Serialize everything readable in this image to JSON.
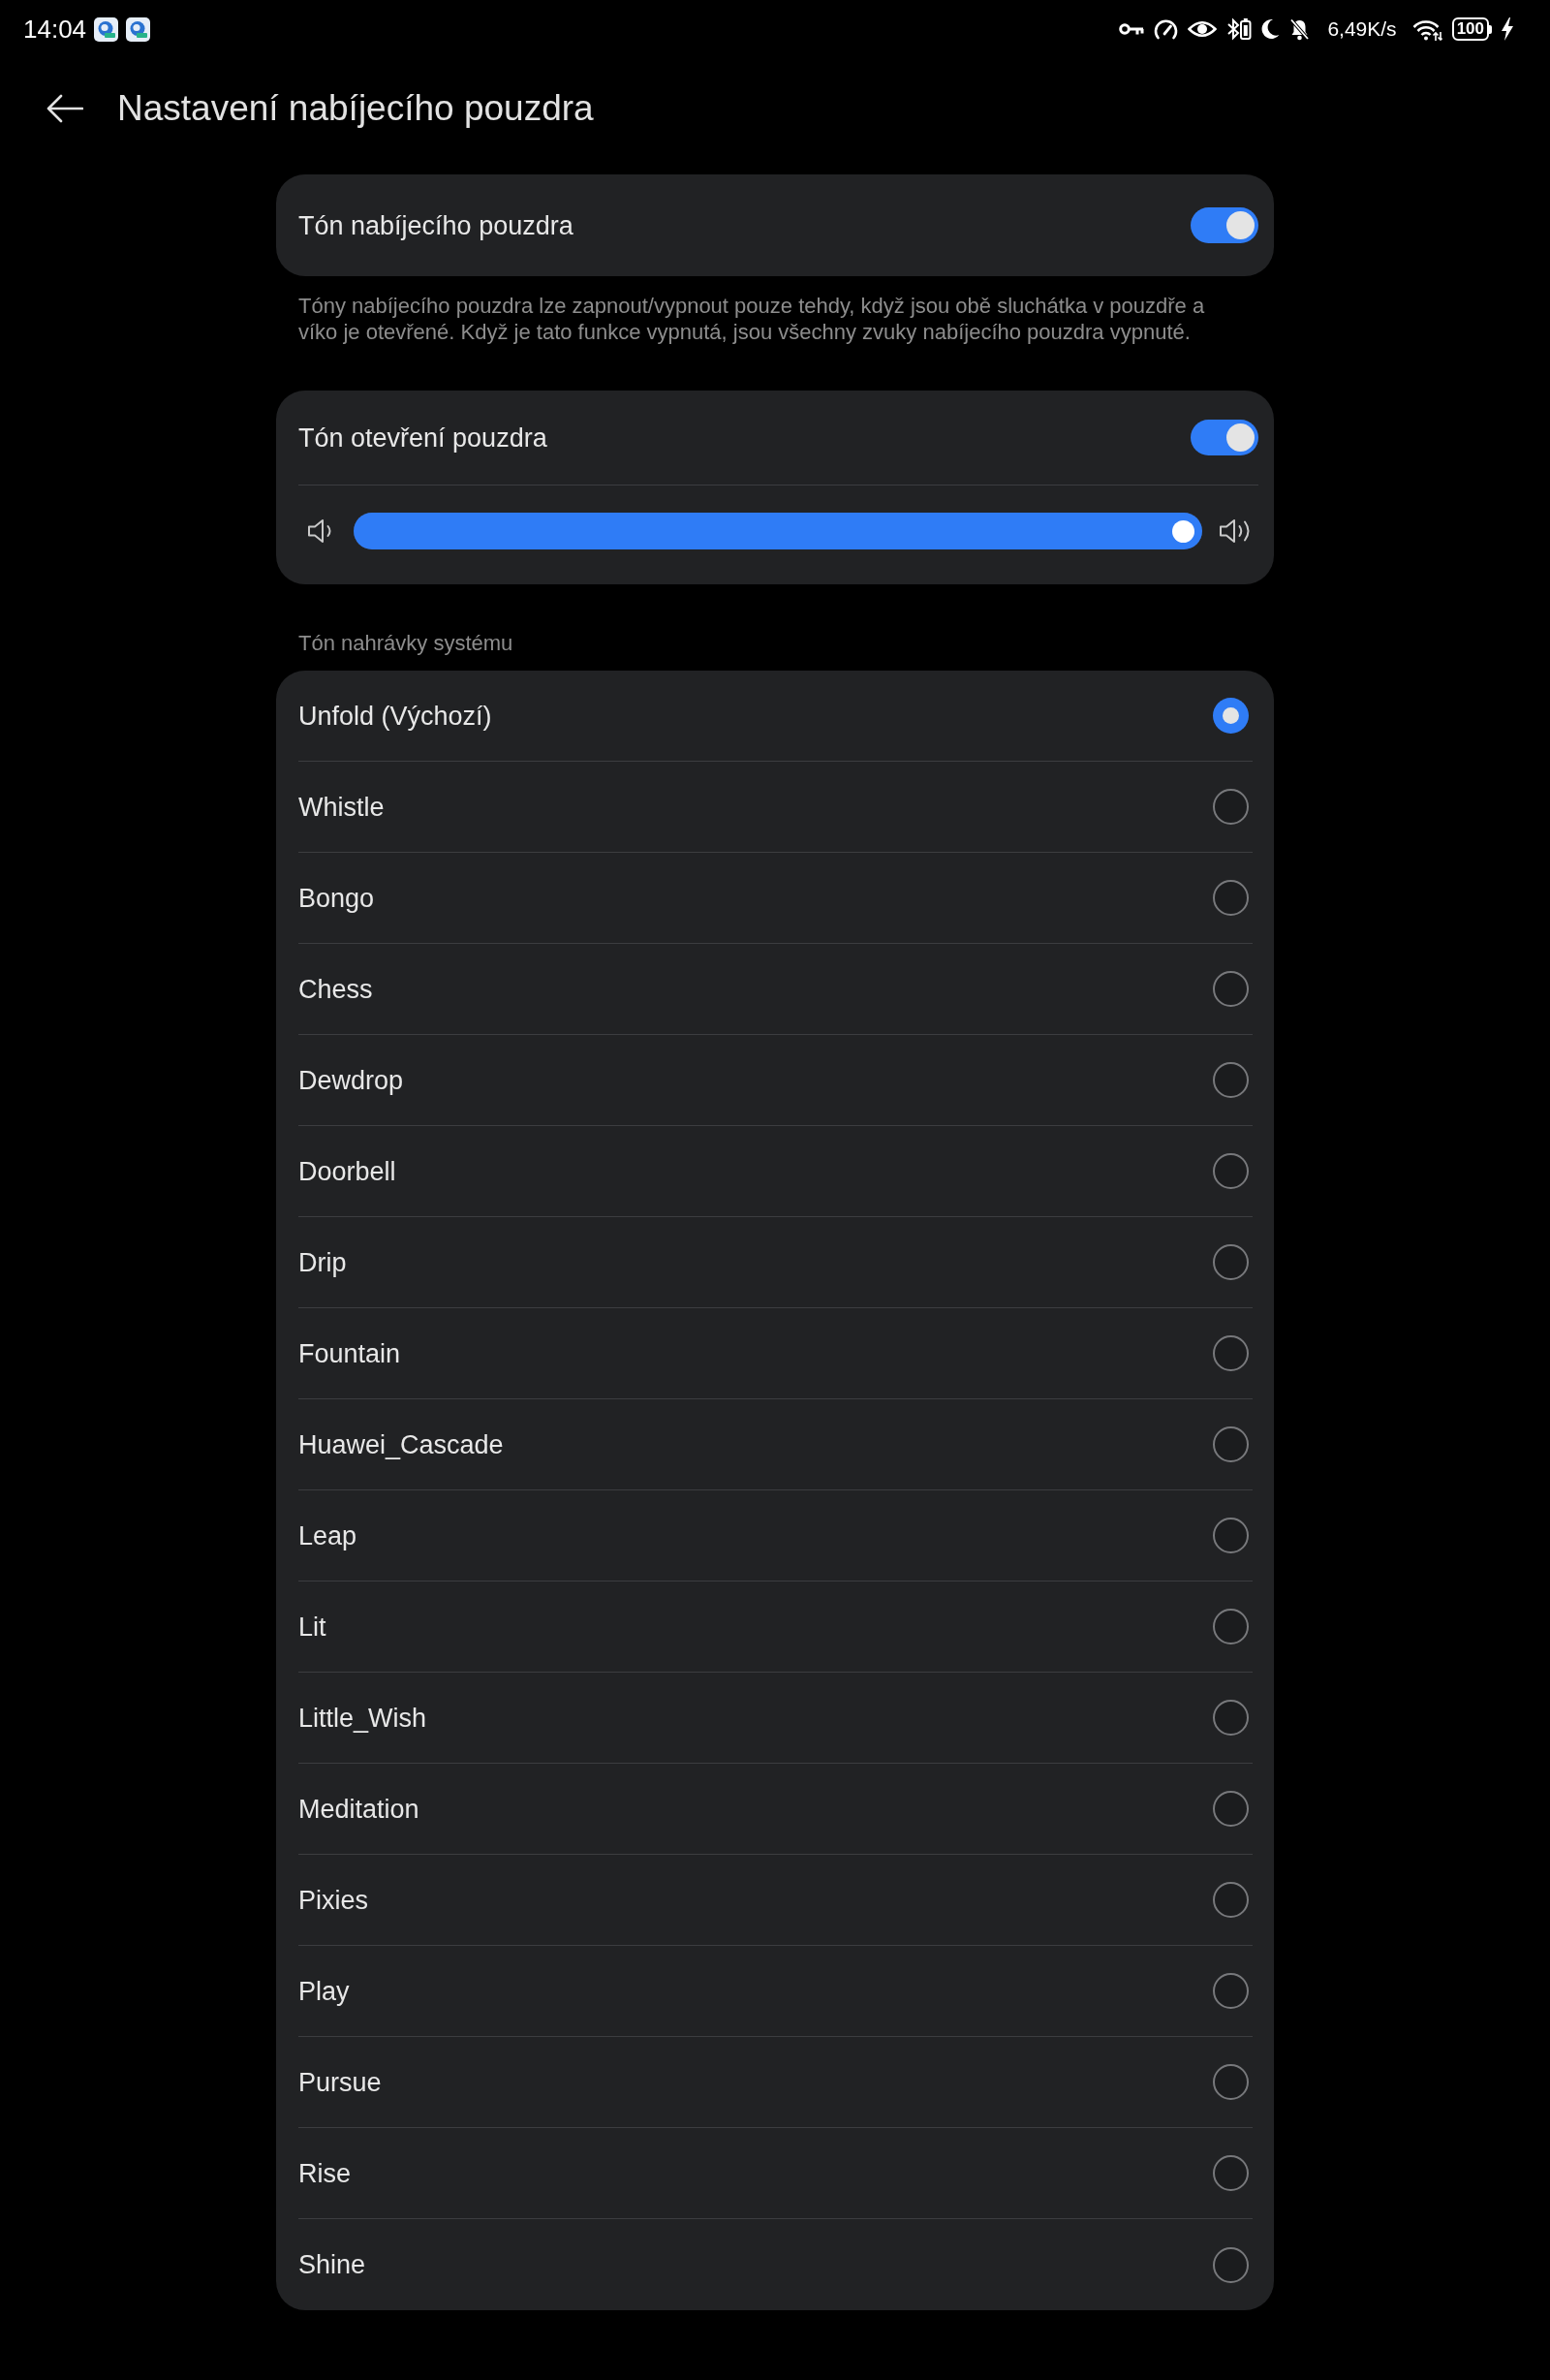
{
  "status_bar": {
    "time": "14:04",
    "network_speed": "6,49K/s",
    "battery": "100"
  },
  "header": {
    "title": "Nastavení nabíjecího pouzdra"
  },
  "case_tone": {
    "label": "Tón nabíjecího pouzdra",
    "on": true,
    "description": "Tóny nabíjecího pouzdra lze zapnout/vypnout pouze tehdy, když jsou obě sluchátka v pouzdře a víko je otevřené. Když je tato funkce vypnutá, jsou všechny zvuky nabíjecího pouzdra vypnuté."
  },
  "open_tone": {
    "label": "Tón otevření pouzdra",
    "on": true,
    "volume": {
      "level": 1
    }
  },
  "system_tones": {
    "heading": "Tón nahrávky systému",
    "items": [
      {
        "label": "Unfold (Výchozí)",
        "selected": true
      },
      {
        "label": "Whistle",
        "selected": false
      },
      {
        "label": "Bongo",
        "selected": false
      },
      {
        "label": "Chess",
        "selected": false
      },
      {
        "label": "Dewdrop",
        "selected": false
      },
      {
        "label": "Doorbell",
        "selected": false
      },
      {
        "label": "Drip",
        "selected": false
      },
      {
        "label": "Fountain",
        "selected": false
      },
      {
        "label": "Huawei_Cascade",
        "selected": false
      },
      {
        "label": "Leap",
        "selected": false
      },
      {
        "label": "Lit",
        "selected": false
      },
      {
        "label": "Little_Wish",
        "selected": false
      },
      {
        "label": "Meditation",
        "selected": false
      },
      {
        "label": "Pixies",
        "selected": false
      },
      {
        "label": "Play",
        "selected": false
      },
      {
        "label": "Pursue",
        "selected": false
      },
      {
        "label": "Rise",
        "selected": false
      },
      {
        "label": "Shine",
        "selected": false
      }
    ]
  }
}
